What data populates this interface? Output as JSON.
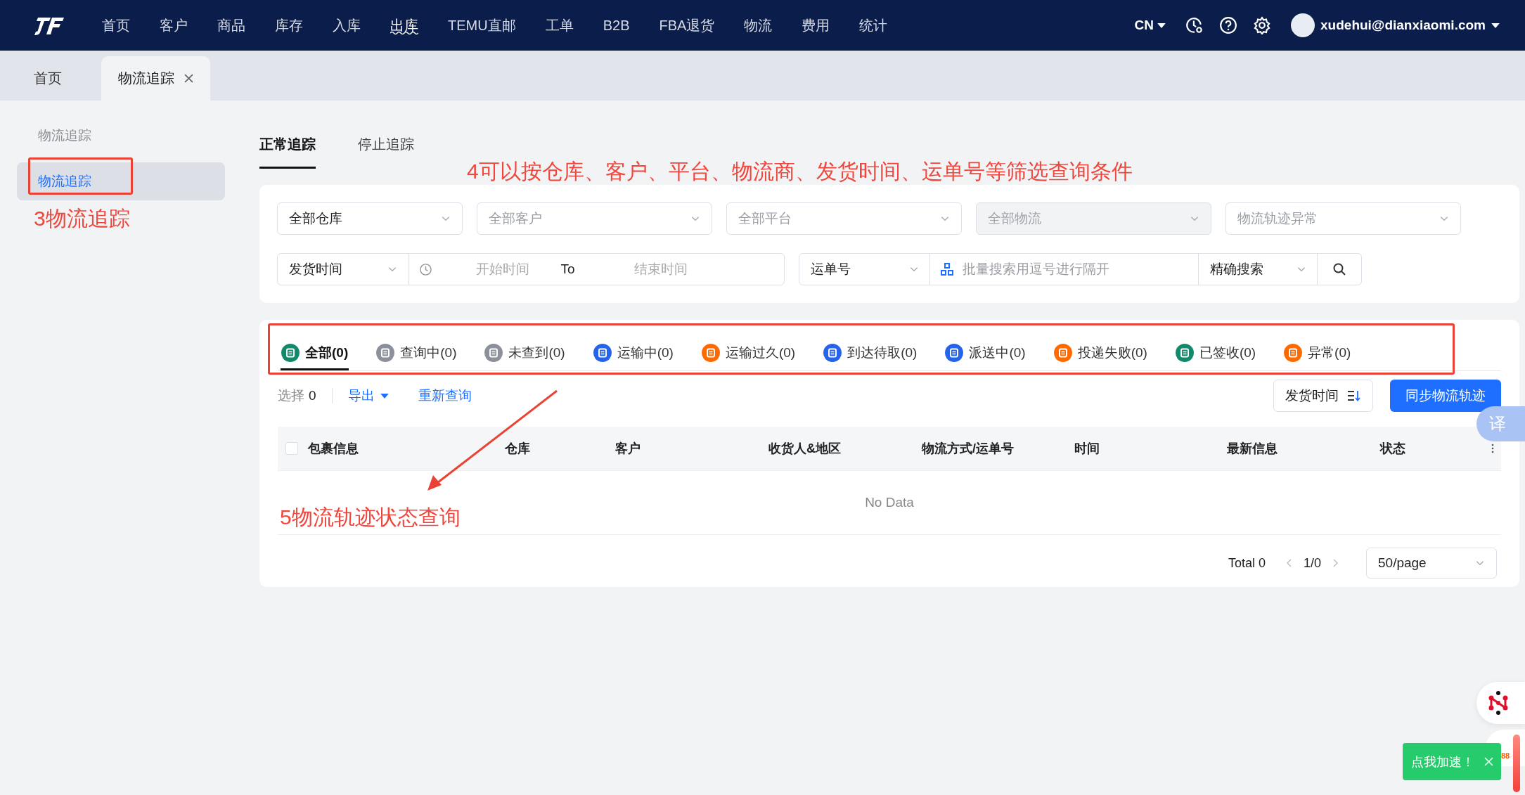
{
  "nav": {
    "items": [
      {
        "label": "首页",
        "selected": false
      },
      {
        "label": "客户",
        "selected": false
      },
      {
        "label": "商品",
        "selected": false
      },
      {
        "label": "库存",
        "selected": false
      },
      {
        "label": "入库",
        "selected": false
      },
      {
        "label": "出库",
        "selected": true
      },
      {
        "label": "TEMU直邮",
        "selected": false
      },
      {
        "label": "工单",
        "selected": false
      },
      {
        "label": "B2B",
        "selected": false
      },
      {
        "label": "FBA退货",
        "selected": false
      },
      {
        "label": "物流",
        "selected": false
      },
      {
        "label": "费用",
        "selected": false
      },
      {
        "label": "统计",
        "selected": false
      }
    ],
    "language": "CN",
    "user": "xudehui@dianxiaomi.com"
  },
  "page_tabs": [
    {
      "label": "首页",
      "selected": false,
      "closable": false
    },
    {
      "label": "物流追踪",
      "selected": true,
      "closable": true
    }
  ],
  "sidebar": {
    "heading": "物流追踪",
    "items": [
      {
        "label": "物流追踪",
        "selected": true
      }
    ]
  },
  "subtabs": [
    {
      "label": "正常追踪",
      "selected": true
    },
    {
      "label": "停止追踪",
      "selected": false
    }
  ],
  "filters": {
    "row_1": [
      {
        "value": "全部仓库",
        "disabled": false
      },
      {
        "placeholder": "全部客户",
        "disabled": false
      },
      {
        "placeholder": "全部平台",
        "disabled": false
      },
      {
        "placeholder": "全部物流",
        "disabled": true
      },
      {
        "placeholder": "物流轨迹异常",
        "disabled": false
      }
    ],
    "time_type": {
      "value": "发货时间"
    },
    "date_range": {
      "start_placeholder": "开始时间",
      "separator": "To",
      "end_placeholder": "结束时间"
    },
    "number_type": {
      "value": "运单号"
    },
    "batch_search": {
      "placeholder": "批量搜索用逗号进行隔开"
    },
    "match_mode": {
      "value": "精确搜索"
    }
  },
  "status_tabs": [
    {
      "label": "全部(0)",
      "selected": true,
      "color": "#13896b"
    },
    {
      "label": "查询中(0)",
      "selected": false,
      "color": "#8b909a"
    },
    {
      "label": "未查到(0)",
      "selected": false,
      "color": "#8b909a"
    },
    {
      "label": "运输中(0)",
      "selected": false,
      "color": "#2563eb"
    },
    {
      "label": "运输过久(0)",
      "selected": false,
      "color": "#ff6a00"
    },
    {
      "label": "到达待取(0)",
      "selected": false,
      "color": "#2563eb"
    },
    {
      "label": "派送中(0)",
      "selected": false,
      "color": "#2563eb"
    },
    {
      "label": "投递失败(0)",
      "selected": false,
      "color": "#ff6a00"
    },
    {
      "label": "已签收(0)",
      "selected": false,
      "color": "#13896b"
    },
    {
      "label": "异常(0)",
      "selected": false,
      "color": "#ff6a00"
    }
  ],
  "toolbar": {
    "selection_label": "选择",
    "selection_count": "0",
    "export": "导出",
    "requery": "重新查询",
    "sort": "发货时间",
    "sync": "同步物流轨迹"
  },
  "table": {
    "select_all": {
      "checked": false
    },
    "columns": [
      "包裹信息",
      "仓库",
      "客户",
      "收货人&地区",
      "物流方式/运单号",
      "时间",
      "最新信息",
      "状态"
    ],
    "empty_text": "No Data"
  },
  "pagination": {
    "total": "Total 0",
    "page": "1/0",
    "page_size": "50/page"
  },
  "annotations": [
    {
      "kind": "frame"
    },
    {
      "kind": "text",
      "text": "3物流追踪"
    },
    {
      "kind": "text",
      "text": "4可以按仓库、客户、平台、物流商、发货时间、运单号等筛选查询条件"
    },
    {
      "kind": "frame"
    },
    {
      "kind": "arrow"
    },
    {
      "kind": "text",
      "text": "5物流轨迹状态查询"
    }
  ],
  "widgets": {
    "translate": "译",
    "badge": "88",
    "toast": "点我加速！"
  }
}
